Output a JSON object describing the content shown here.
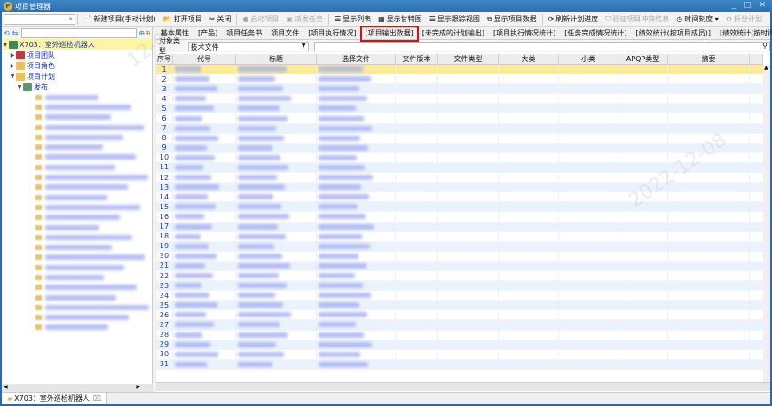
{
  "window": {
    "title": "项目管理器",
    "logo": "P",
    "controls": "_ ▢ ✕"
  },
  "toolbar": {
    "items": [
      {
        "icon": "📄",
        "label": "新建项目(手动计划)",
        "enabled": true
      },
      {
        "icon": "📂",
        "label": "打开项目",
        "enabled": true
      },
      {
        "icon": "✂",
        "label": "关闭",
        "enabled": true
      },
      {
        "icon": "●",
        "label": "启动项目",
        "enabled": false
      },
      {
        "icon": "▣",
        "label": "派发任务",
        "enabled": false
      },
      {
        "icon": "☰",
        "label": "显示列表",
        "enabled": true
      },
      {
        "icon": "▦",
        "label": "显示甘特图",
        "enabled": true
      },
      {
        "icon": "☰",
        "label": "显示跟踪视图",
        "enabled": true
      },
      {
        "icon": "⧉",
        "label": "显示项目数据",
        "enabled": true
      },
      {
        "icon": "⟳",
        "label": "刷新计划进度",
        "enabled": true
      },
      {
        "icon": "⛉",
        "label": "验证项目冲突信息",
        "enabled": false
      },
      {
        "icon": "◷",
        "label": "时间刻度 ▾",
        "enabled": true
      },
      {
        "icon": "⚙",
        "label": "拆分计划",
        "enabled": false
      }
    ],
    "combo_arrow": "»"
  },
  "tree": {
    "root": "X703：室外巡检机器人",
    "team": "项目团队",
    "role": "项目角色",
    "plan": "项目计划",
    "publish": "发布",
    "leaf_count": 24
  },
  "tabs": [
    "基本属性",
    "[产品]",
    "项目任务书",
    "项目文件",
    "[项目执行情况]",
    "[项目输出数据]",
    "[未完成的计划输出]",
    "[项目执行情况统计]",
    "[任务完成情况统计]",
    "[绩效统计(按项目成员)]",
    "[绩效统计(按时间)]"
  ],
  "tabs_more": "»",
  "active_tab": "[项目输出数据]",
  "filter": {
    "label": "对象类型",
    "value": "技术文件",
    "search_placeholder": ""
  },
  "grid": {
    "columns": [
      "序号",
      "代号",
      "标题",
      "选择文件",
      "文件版本",
      "文件类型",
      "大类",
      "小类",
      "APQP类型",
      "摘要"
    ],
    "row_count": 31,
    "selected_row": 1
  },
  "bottom_tab": {
    "label": "X703：室外巡检机器人",
    "close": "⌧"
  },
  "colors": {
    "accent": "#2a6fb0",
    "selected": "#fde99a",
    "highlight": "#e01010"
  }
}
